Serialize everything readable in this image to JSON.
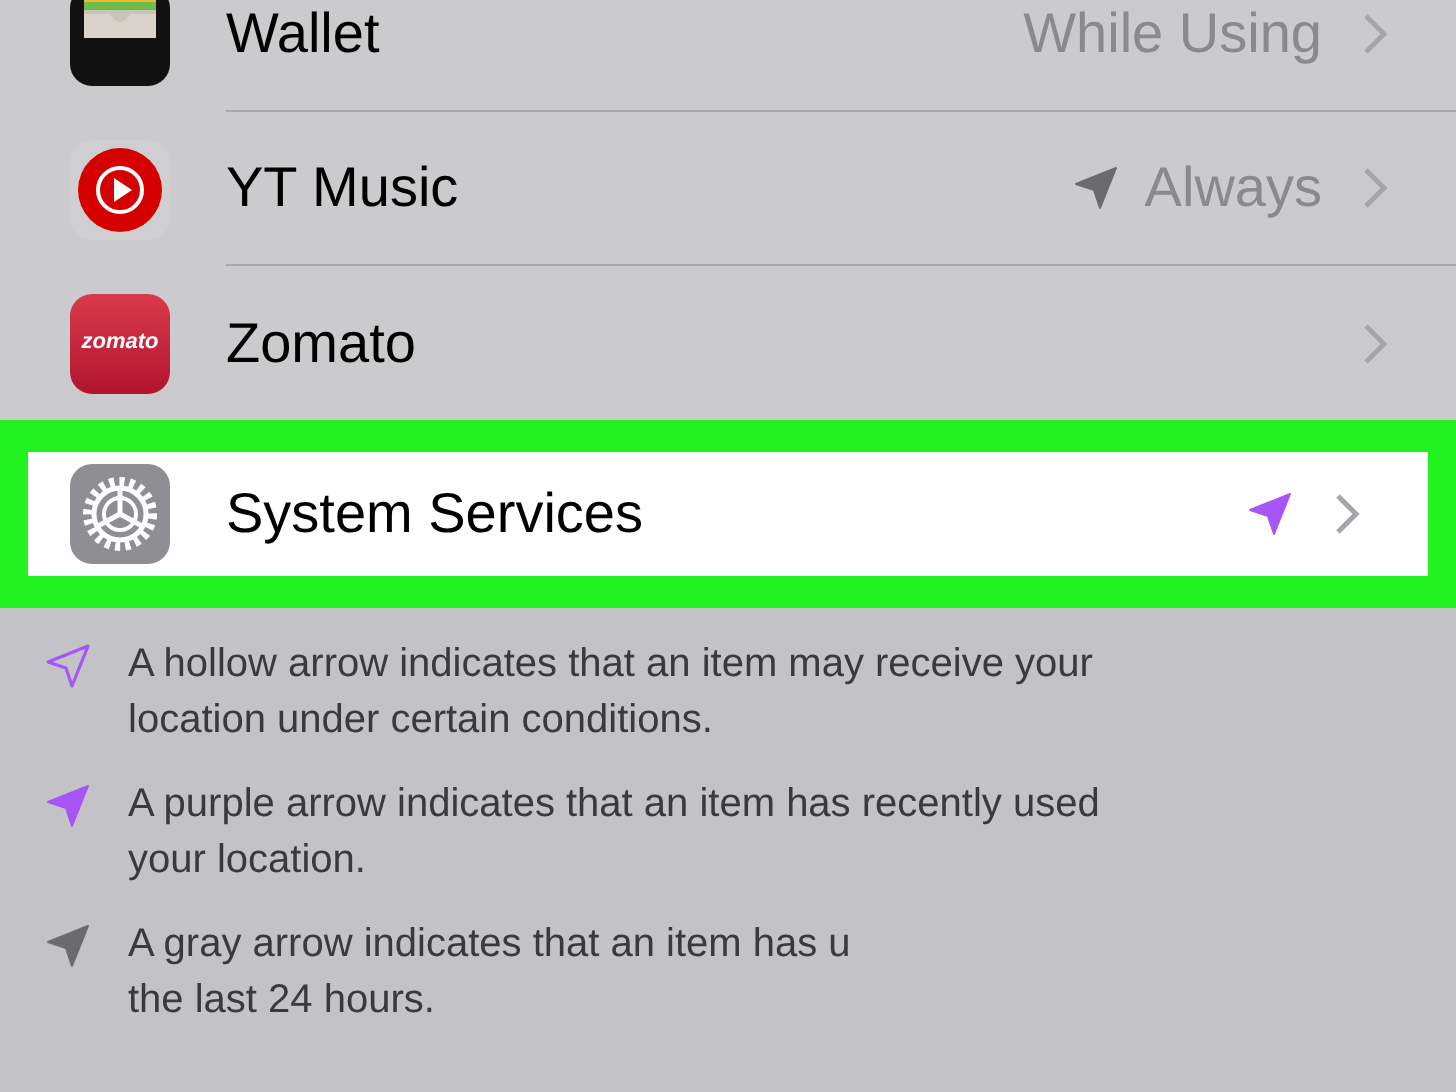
{
  "apps": [
    {
      "name": "Wallet",
      "value": "While Using",
      "highlighted": false
    },
    {
      "name": "YT Music",
      "value": "Always",
      "color": "#6b6b6f",
      "highlighted": false
    },
    {
      "name": "Zomato",
      "icon_text": "zomato",
      "highlighted": false
    },
    {
      "name": "System Services",
      "color": "#a855f7",
      "highlighted": true
    }
  ],
  "notes": [
    {
      "kind": "hollow",
      "color": "#a855f7",
      "lines": [
        "A hollow arrow indicates that an item may receive your",
        "location under certain conditions."
      ]
    },
    {
      "kind": "filled",
      "color": "#a855f7",
      "lines": [
        "A purple arrow indicates that an item has recently used",
        "your location."
      ]
    },
    {
      "kind": "filled",
      "color": "#6b6b6f",
      "lines": [
        "A gray arrow indicates that an item has u",
        "the last 24 hours."
      ]
    }
  ]
}
